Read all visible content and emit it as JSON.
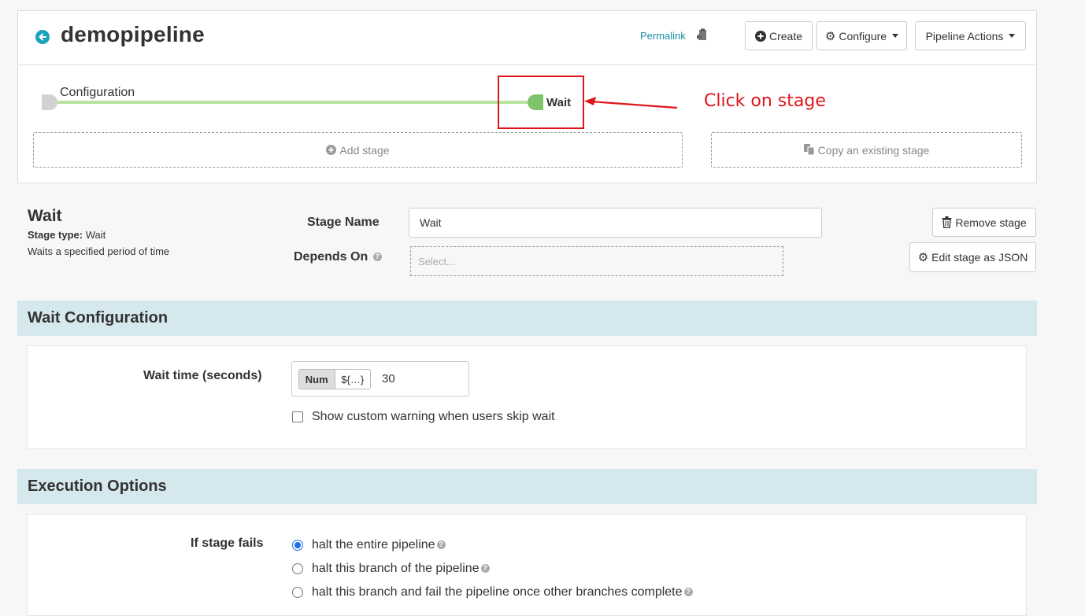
{
  "header": {
    "title": "demopipeline",
    "permalink": "Permalink",
    "create_label": "Create",
    "configure_label": "Configure",
    "pipeline_actions_label": "Pipeline Actions"
  },
  "graph": {
    "config_node_label": "Configuration",
    "wait_node_label": "Wait",
    "add_stage_label": "Add stage",
    "copy_stage_label": "Copy an existing stage"
  },
  "annotation": {
    "text": "Click on stage",
    "color": "#e0151b"
  },
  "stage": {
    "heading": "Wait",
    "type_label": "Stage type:",
    "type_value": "Wait",
    "description": "Waits a specified period of time",
    "name_label": "Stage Name",
    "name_value": "Wait",
    "depends_label": "Depends On",
    "depends_placeholder": "Select...",
    "remove_label": "Remove stage",
    "edit_json_label": "Edit stage as JSON"
  },
  "wait_config": {
    "title": "Wait Configuration",
    "wait_time_label": "Wait time (seconds)",
    "toggle_num": "Num",
    "toggle_expr": "${…}",
    "wait_time_value": "30",
    "custom_warning_label": "Show custom warning when users skip wait"
  },
  "execution": {
    "title": "Execution Options",
    "if_fails_label": "If stage fails",
    "options": [
      {
        "label": "halt the entire pipeline",
        "selected": true
      },
      {
        "label": "halt this branch of the pipeline",
        "selected": false
      },
      {
        "label": "halt this branch and fail the pipeline once other branches complete",
        "selected": false
      }
    ]
  },
  "colors": {
    "accent": "#1aa3ba",
    "section_bg": "#d5e8ee",
    "graph_line": "#b5e39b",
    "wait_node": "#7fc36d"
  }
}
